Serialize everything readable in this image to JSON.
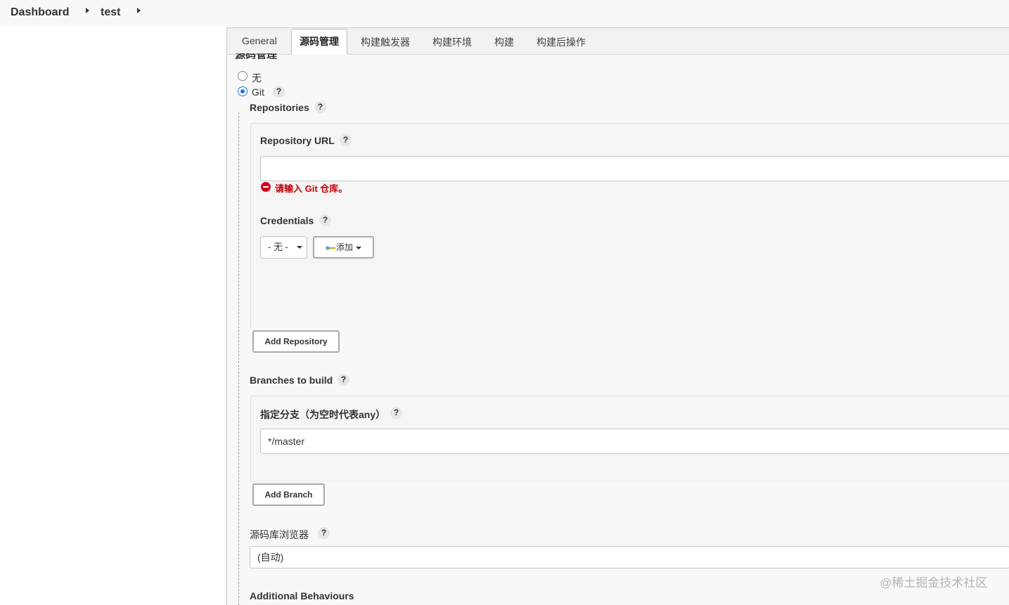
{
  "breadcrumb": {
    "items": [
      "Dashboard",
      "test"
    ]
  },
  "tabs": [
    "General",
    "源码管理",
    "构建触发器",
    "构建环境",
    "构建",
    "构建后操作"
  ],
  "active_tab": "源码管理",
  "scm": {
    "section_title": "源码管理",
    "options": [
      {
        "label": "无",
        "checked": false
      },
      {
        "label": "Git",
        "checked": true
      }
    ],
    "help_glyph": "?",
    "repositories_label": "Repositories",
    "repo_url_label": "Repository URL",
    "repo_url_value": "",
    "repo_url_error": "请输入 Git 仓库。",
    "credentials_label": "Credentials",
    "credentials_selected": "- 无 -",
    "add_credentials_label": "添加",
    "add_repository_label": "Add Repository",
    "branches_label": "Branches to build",
    "branch_specifier_label": "指定分支（为空时代表any）",
    "branch_specifier_value": "*/master",
    "add_branch_label": "Add Branch",
    "repo_browser_label": "源码库浏览器",
    "repo_browser_value": "(自动)",
    "additional_behaviours_label": "Additional Behaviours"
  },
  "watermark": "@稀土掘金技术社区"
}
